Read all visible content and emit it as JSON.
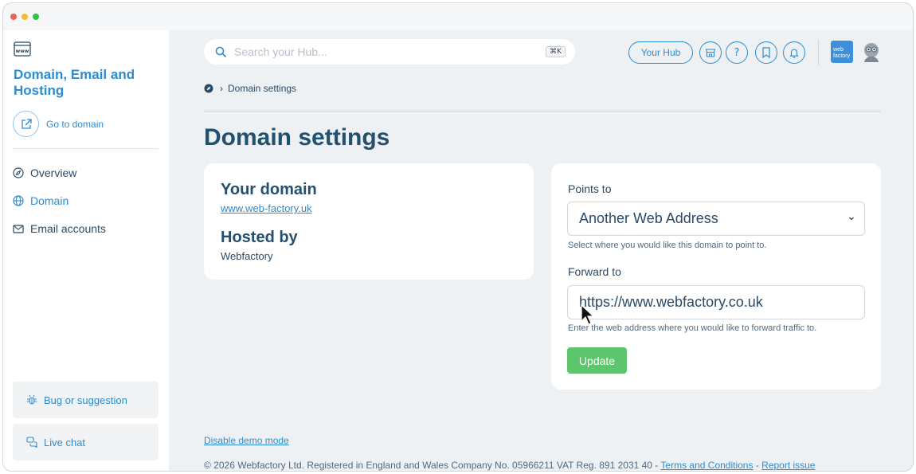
{
  "colors": {
    "accent": "#2d8ccf",
    "title": "#24506f",
    "success": "#5cc56e",
    "background": "#eef1f4"
  },
  "sidebar": {
    "title": "Domain, Email and Hosting",
    "go_to_domain": "Go to domain",
    "items": [
      {
        "label": "Overview",
        "icon": "compass-icon",
        "active": false
      },
      {
        "label": "Domain",
        "icon": "globe-icon",
        "active": true
      },
      {
        "label": "Email accounts",
        "icon": "envelope-icon",
        "active": false
      }
    ],
    "bug_label": "Bug or suggestion",
    "chat_label": "Live chat"
  },
  "topbar": {
    "search_placeholder": "Search your Hub...",
    "shortcut": "⌘K",
    "your_hub": "Your Hub",
    "brand_logo_text": "web factory"
  },
  "breadcrumb": {
    "current": "Domain settings"
  },
  "page_title": "Domain settings",
  "domain_card": {
    "your_domain_heading": "Your domain",
    "domain_link": "www.web-factory.uk",
    "hosted_by_heading": "Hosted by",
    "hosted_by_value": "Webfactory"
  },
  "settings_form": {
    "points_to_label": "Points to",
    "points_to_value": "Another Web Address",
    "points_to_help": "Select where you would like this domain to point to.",
    "forward_to_label": "Forward to",
    "forward_to_value": "https://www.webfactory.co.uk",
    "forward_to_help": "Enter the web address where you would like to forward traffic to.",
    "update_label": "Update"
  },
  "footer": {
    "demo_mode_link": "Disable demo mode",
    "copyright": "© 2026 Webfactory Ltd. Registered in England and Wales Company No. 05966211 VAT Reg. 891 2031 40 - ",
    "terms_link": "Terms and Conditions",
    "separator": " - ",
    "report_link": "Report issue"
  }
}
